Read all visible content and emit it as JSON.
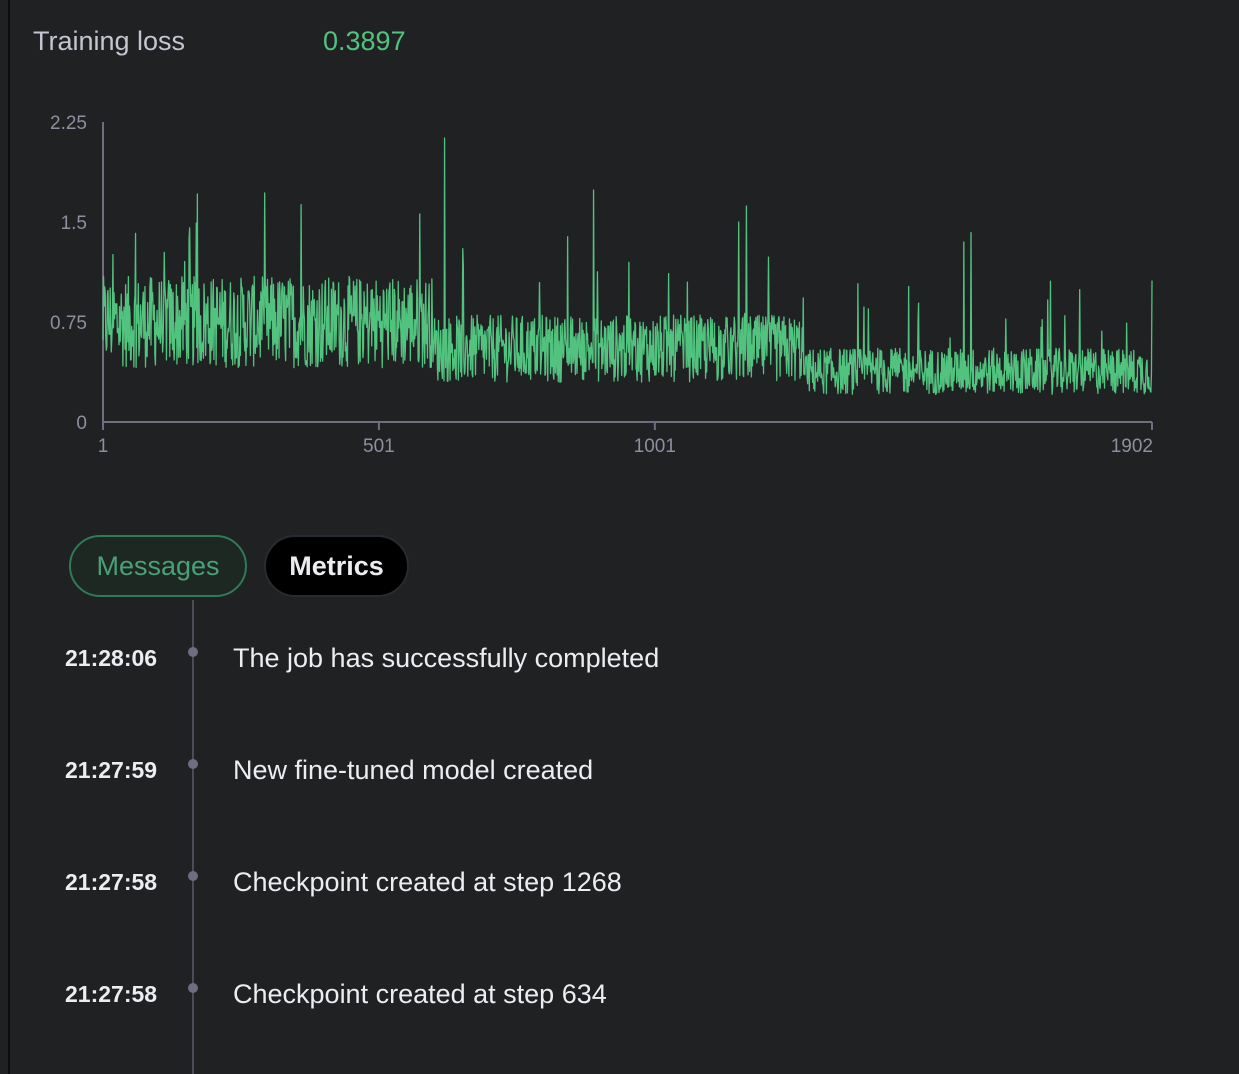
{
  "metric": {
    "label": "Training loss",
    "value": "0.3897"
  },
  "colors": {
    "accent": "#52c27f",
    "background": "#202123",
    "axis": "#6e6e80",
    "timeline": "#4b4c55"
  },
  "chart_data": {
    "type": "line",
    "title": "",
    "xlabel": "",
    "ylabel": "",
    "xlim": [
      1,
      1902
    ],
    "ylim": [
      0,
      2.25
    ],
    "xticks": [
      "1",
      "501",
      "1001",
      "1902"
    ],
    "yticks": [
      "0",
      "0.75",
      "1.5",
      "2.25"
    ],
    "grid": false,
    "series": [
      {
        "color": "#52c27f",
        "n_points": 1902,
        "baseline_segments": [
          {
            "x": [
              1,
              600
            ],
            "mean": 0.75
          },
          {
            "x": [
              600,
              1270
            ],
            "mean": 0.55
          },
          {
            "x": [
              1270,
              1902
            ],
            "mean": 0.38
          }
        ],
        "peaks": [
          {
            "x": 620,
            "y": 2.13
          },
          {
            "x": 890,
            "y": 1.74
          },
          {
            "x": 1167,
            "y": 1.62
          },
          {
            "x": 1153,
            "y": 1.5
          },
          {
            "x": 172,
            "y": 1.71
          },
          {
            "x": 360,
            "y": 1.63
          },
          {
            "x": 575,
            "y": 1.56
          },
          {
            "x": 1574,
            "y": 1.42
          },
          {
            "x": 1561,
            "y": 1.35
          },
          {
            "x": 1902,
            "y": 1.06
          }
        ],
        "last_value": 0.3897
      }
    ]
  },
  "tabs": [
    {
      "label": "Messages",
      "active": true
    },
    {
      "label": "Metrics",
      "active": false
    }
  ],
  "messages": [
    {
      "time": "21:28:06",
      "text": "The job has successfully completed"
    },
    {
      "time": "21:27:59",
      "text": "New fine-tuned model created"
    },
    {
      "time": "21:27:58",
      "text": "Checkpoint created at step 1268"
    },
    {
      "time": "21:27:58",
      "text": "Checkpoint created at step 634"
    }
  ]
}
